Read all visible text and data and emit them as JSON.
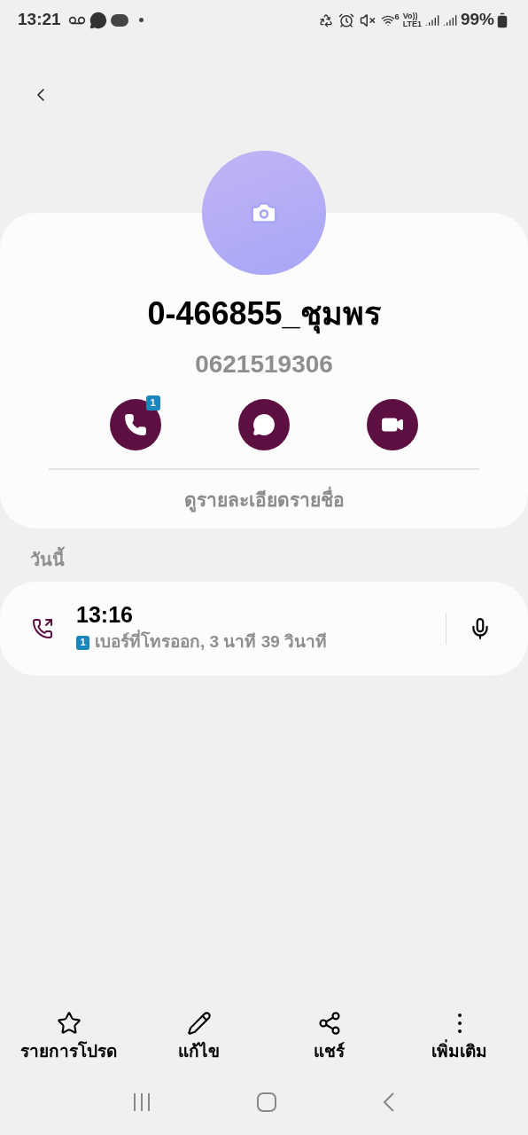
{
  "status_bar": {
    "time": "13:21",
    "wifi_label": "6",
    "volte_label": "Vo))",
    "lte_label": "LTE1",
    "battery": "99%"
  },
  "contact": {
    "name": "0-466855_ชุมพร",
    "number": "0621519306",
    "actions": [
      {
        "kind": "call",
        "badge": "1"
      },
      {
        "kind": "message"
      },
      {
        "kind": "video"
      }
    ],
    "details_link": "ดูรายละเอียดรายชื่อ"
  },
  "section_title": "วันนี้",
  "calls": [
    {
      "time": "13:16",
      "sim": "1",
      "detail": "เบอร์ที่โทรออก, 3 นาที 39 วินาที"
    }
  ],
  "bottom_actions": [
    {
      "kind": "favorite",
      "label": "รายการโปรด"
    },
    {
      "kind": "edit",
      "label": "แก้ไข"
    },
    {
      "kind": "share",
      "label": "แชร์"
    },
    {
      "kind": "more",
      "label": "เพิ่มเติม"
    }
  ]
}
